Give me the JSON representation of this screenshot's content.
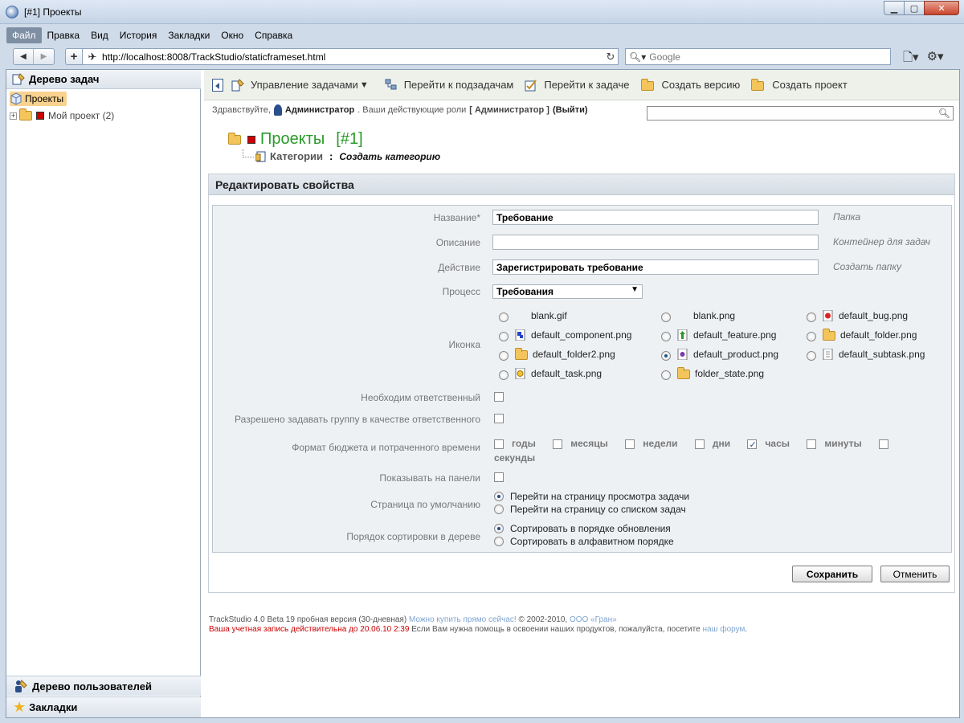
{
  "window": {
    "title": "[#1] Проекты"
  },
  "menu": [
    "Файл",
    "Правка",
    "Вид",
    "История",
    "Закладки",
    "Окно",
    "Справка"
  ],
  "nav": {
    "url": "http://localhost:8008/TrackStudio/staticframeset.html",
    "search_placeholder": "Google"
  },
  "sidebar": {
    "header": "Дерево задач",
    "root": "Проекты",
    "node": "Мой проект (2)",
    "footer1": "Дерево пользователей",
    "footer2": "Закладки"
  },
  "toolbar": {
    "items": [
      "Управление задачами",
      "Перейти к подзадачам",
      "Перейти к задаче",
      "Создать версию",
      "Создать проект"
    ]
  },
  "greeting": {
    "hello": "Здравствуйте,",
    "user": "Администратор",
    "roles_text": ". Ваши действующие роли",
    "role": "[ Администратор ]",
    "logout": "(Выйти)"
  },
  "crumb": {
    "title": "Проекты",
    "number": "[#1]",
    "category": "Категории",
    "create": "Создать категорию"
  },
  "panel": {
    "title": "Редактировать свойства"
  },
  "form": {
    "name_label": "Название*",
    "name_value": "Требование",
    "name_hint": "Папка",
    "desc_label": "Описание",
    "desc_value": "",
    "desc_hint": "Контейнер для задач",
    "action_label": "Действие",
    "action_value": "Зарегистрировать требование",
    "action_hint": "Создать папку",
    "process_label": "Процесс",
    "process_value": "Требования",
    "icon_label": "Иконка",
    "icons": [
      {
        "name": "blank.gif",
        "selected": false
      },
      {
        "name": "blank.png",
        "selected": false
      },
      {
        "name": "default_bug.png",
        "selected": false
      },
      {
        "name": "default_component.png",
        "selected": false
      },
      {
        "name": "default_feature.png",
        "selected": false
      },
      {
        "name": "default_folder.png",
        "selected": false
      },
      {
        "name": "default_folder2.png",
        "selected": false
      },
      {
        "name": "default_product.png",
        "selected": true
      },
      {
        "name": "default_subtask.png",
        "selected": false
      },
      {
        "name": "default_task.png",
        "selected": false
      },
      {
        "name": "folder_state.png",
        "selected": false
      }
    ],
    "need_resp_label": "Необходим ответственный",
    "allow_group_label": "Разрешено задавать группу в качестве ответственного",
    "budget_label": "Формат бюджета и потраченного времени",
    "budget_units": [
      {
        "name": "годы",
        "checked": false
      },
      {
        "name": "месяцы",
        "checked": false
      },
      {
        "name": "недели",
        "checked": false
      },
      {
        "name": "дни",
        "checked": false
      },
      {
        "name": "часы",
        "checked": true
      },
      {
        "name": "минуты",
        "checked": false
      },
      {
        "name": "секунды",
        "checked": false
      }
    ],
    "show_panel_label": "Показывать на панели",
    "default_page_label": "Страница по умолчанию",
    "default_page_opt1": "Перейти на страницу просмотра задачи",
    "default_page_opt2": "Перейти на страницу со списком задач",
    "sort_label": "Порядок сортировки в дереве",
    "sort_opt1": "Сортировать в порядке обновления",
    "sort_opt2": "Сортировать в алфавитном порядке",
    "save": "Сохранить",
    "cancel": "Отменить"
  },
  "footer": {
    "line1_a": "TrackStudio 4.0 Beta 19 пробная версия (30-дневная)",
    "line1_link": "Можно купить прямо сейчас!",
    "line1_b": "© 2002-2010,",
    "line1_company": "ООО «Гран»",
    "line2_red": "Ваша учетная запись действительна до 20.06.10 2:39",
    "line2_text": "Если Вам нужна помощь в освоении наших продуктов, пожалуйста, посетите",
    "line2_link": "наш форум"
  }
}
